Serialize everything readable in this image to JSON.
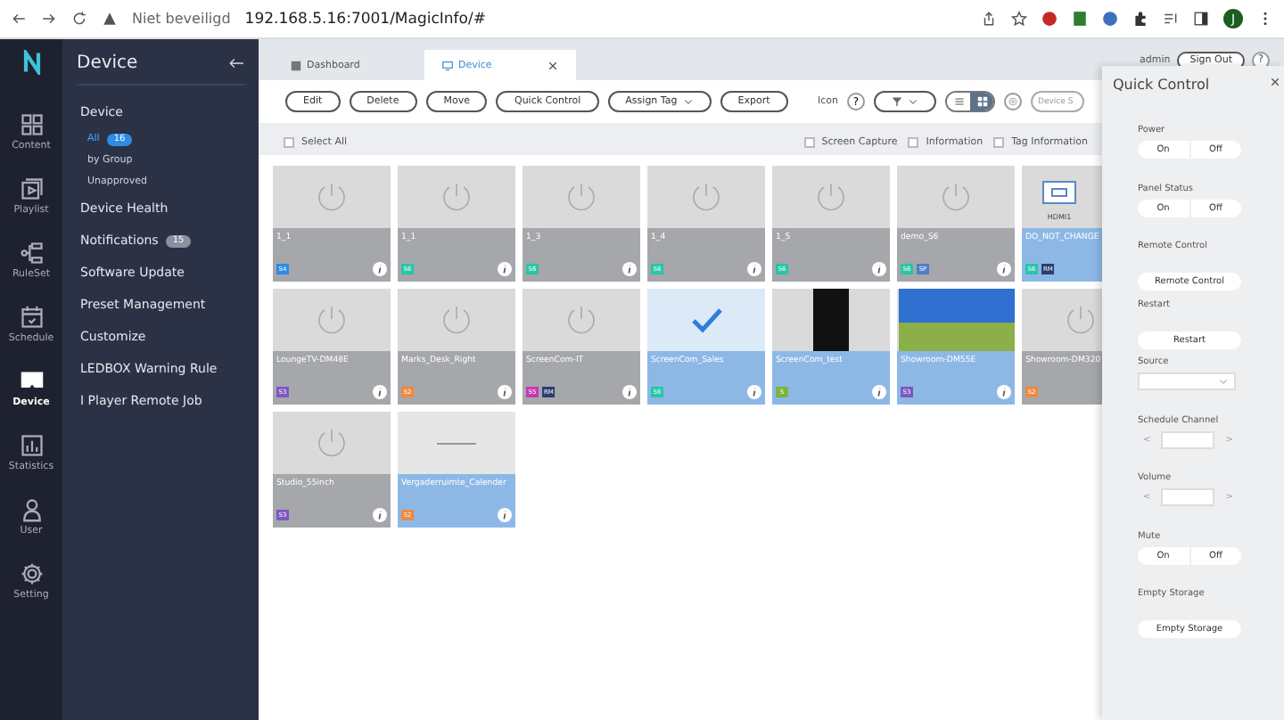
{
  "browser": {
    "security": "Niet beveiligd",
    "url": "192.168.5.16:7001/MagicInfo/#",
    "profile": "J"
  },
  "rail": [
    {
      "label": "Content",
      "selected": false
    },
    {
      "label": "Playlist",
      "selected": false
    },
    {
      "label": "RuleSet",
      "selected": false
    },
    {
      "label": "Schedule",
      "selected": false
    },
    {
      "label": "Device",
      "selected": true
    },
    {
      "label": "Statistics",
      "selected": false
    },
    {
      "label": "User",
      "selected": false
    },
    {
      "label": "Setting",
      "selected": false
    }
  ],
  "sidebar": {
    "title": "Device",
    "items": [
      {
        "label": "Device",
        "kind": "heading"
      },
      {
        "label": "All",
        "kind": "sub",
        "badge": "16",
        "selected": true
      },
      {
        "label": "by Group",
        "kind": "sub",
        "selected": false
      },
      {
        "label": "Unapproved",
        "kind": "sub",
        "selected": false
      },
      {
        "label": "Device Health",
        "kind": "item"
      },
      {
        "label": "Notifications",
        "kind": "item",
        "badge": "15"
      },
      {
        "label": "Software Update",
        "kind": "item"
      },
      {
        "label": "Preset Management",
        "kind": "item"
      },
      {
        "label": "Customize",
        "kind": "item"
      },
      {
        "label": "LEDBOX Warning Rule",
        "kind": "item"
      },
      {
        "label": "I Player Remote Job",
        "kind": "item"
      }
    ]
  },
  "tabs": [
    {
      "label": "Dashboard",
      "selected": false,
      "closable": false
    },
    {
      "label": "Device",
      "selected": true,
      "closable": true
    }
  ],
  "header": {
    "user": "admin",
    "sign_out": "Sign Out",
    "help": "?"
  },
  "toolbar": {
    "buttons": [
      {
        "label": "Edit",
        "dropdown": false
      },
      {
        "label": "Delete",
        "dropdown": false
      },
      {
        "label": "Move",
        "dropdown": false
      },
      {
        "label": "Quick Control",
        "dropdown": false
      },
      {
        "label": "Assign Tag",
        "dropdown": true
      },
      {
        "label": "Export",
        "dropdown": false
      }
    ],
    "view_label": "Icon",
    "view_help": "?",
    "view_modes": [
      {
        "kind": "list",
        "selected": false
      },
      {
        "kind": "grid",
        "selected": true
      }
    ],
    "search": {
      "placeholder": "Device S"
    }
  },
  "options": [
    {
      "label": "Select All",
      "checked": false
    },
    {
      "label": "Screen Capture",
      "checked": false
    },
    {
      "label": "Information",
      "checked": false
    },
    {
      "label": "Tag Information",
      "checked": false
    }
  ],
  "devices": [
    {
      "name": "1_1",
      "kind": "power",
      "selected": false,
      "tags": [
        {
          "text": "S4",
          "color": "#2d8ce6"
        }
      ]
    },
    {
      "name": "1_1",
      "kind": "power",
      "selected": false,
      "tags": [
        {
          "text": "S6",
          "color": "#26c6a6"
        }
      ]
    },
    {
      "name": "1_3",
      "kind": "power",
      "selected": false,
      "tags": [
        {
          "text": "S6",
          "color": "#26c6a6"
        }
      ]
    },
    {
      "name": "1_4",
      "kind": "power",
      "selected": false,
      "tags": [
        {
          "text": "S6",
          "color": "#26c6a6"
        }
      ]
    },
    {
      "name": "1_5",
      "kind": "power",
      "selected": false,
      "tags": [
        {
          "text": "S6",
          "color": "#26c6a6"
        }
      ]
    },
    {
      "name": "demo_S6",
      "kind": "power",
      "selected": false,
      "tags": [
        {
          "text": "S6",
          "color": "#26c6a6"
        },
        {
          "text": "SP",
          "color": "#4f7fc6"
        }
      ]
    },
    {
      "name": "DO_NOT_CHANGE",
      "kind": "hdmi",
      "source": "HDMI1",
      "selected": true,
      "tags": [
        {
          "text": "S6",
          "color": "#26c6a6"
        },
        {
          "text": "RM",
          "color": "#2c3e70"
        }
      ]
    },
    {
      "name": "LoungeTV-DM48E",
      "kind": "power",
      "selected": false,
      "tags": [
        {
          "text": "S3",
          "color": "#7e57c2"
        }
      ]
    },
    {
      "name": "Marks_Desk_Right",
      "kind": "power",
      "selected": false,
      "tags": [
        {
          "text": "S2",
          "color": "#f0883e"
        }
      ]
    },
    {
      "name": "ScreenCom-IT",
      "kind": "power",
      "selected": false,
      "tags": [
        {
          "text": "S5",
          "color": "#c23bb0"
        },
        {
          "text": "RM",
          "color": "#2c3e70"
        }
      ]
    },
    {
      "name": "ScreenCom_Sales",
      "kind": "check",
      "selected": true,
      "tags": [
        {
          "text": "S6",
          "color": "#26c6a6"
        }
      ]
    },
    {
      "name": "ScreenCom_test",
      "kind": "poster",
      "selected": true,
      "tags": [
        {
          "text": "S",
          "color": "#7cb342"
        }
      ]
    },
    {
      "name": "Showroom-DM55E",
      "kind": "photo",
      "selected": true,
      "tags": [
        {
          "text": "S3",
          "color": "#7e57c2"
        }
      ]
    },
    {
      "name": "Showroom-DM320",
      "kind": "power",
      "selected": false,
      "tags": [
        {
          "text": "S2",
          "color": "#f0883e"
        }
      ]
    },
    {
      "name": "Studio_55inch",
      "kind": "power",
      "selected": false,
      "tags": [
        {
          "text": "S3",
          "color": "#7e57c2"
        }
      ]
    },
    {
      "name": "Vergaderruimte_Calender",
      "kind": "line",
      "selected": true,
      "tags": [
        {
          "text": "S2",
          "color": "#f0883e"
        }
      ]
    }
  ],
  "quick_control": {
    "title": "Quick Control",
    "controls": [
      {
        "label": "Power",
        "kind": "toggle",
        "options": [
          "On",
          "Off"
        ]
      },
      {
        "label": "Panel Status",
        "kind": "toggle",
        "options": [
          "On",
          "Off"
        ]
      },
      {
        "label": "Remote Control",
        "kind": "button",
        "button": "Remote Control"
      },
      {
        "label": "Restart",
        "kind": "button",
        "button": "Restart"
      },
      {
        "label": "Source",
        "kind": "select"
      },
      {
        "label": "Schedule Channel",
        "kind": "stepper",
        "prev": "<",
        "next": ">"
      },
      {
        "label": "Volume",
        "kind": "stepper",
        "prev": "<",
        "next": ">"
      },
      {
        "label": "Mute",
        "kind": "toggle",
        "options": [
          "On",
          "Off"
        ]
      },
      {
        "label": "Empty Storage",
        "kind": "button",
        "button": "Empty Storage"
      }
    ]
  }
}
